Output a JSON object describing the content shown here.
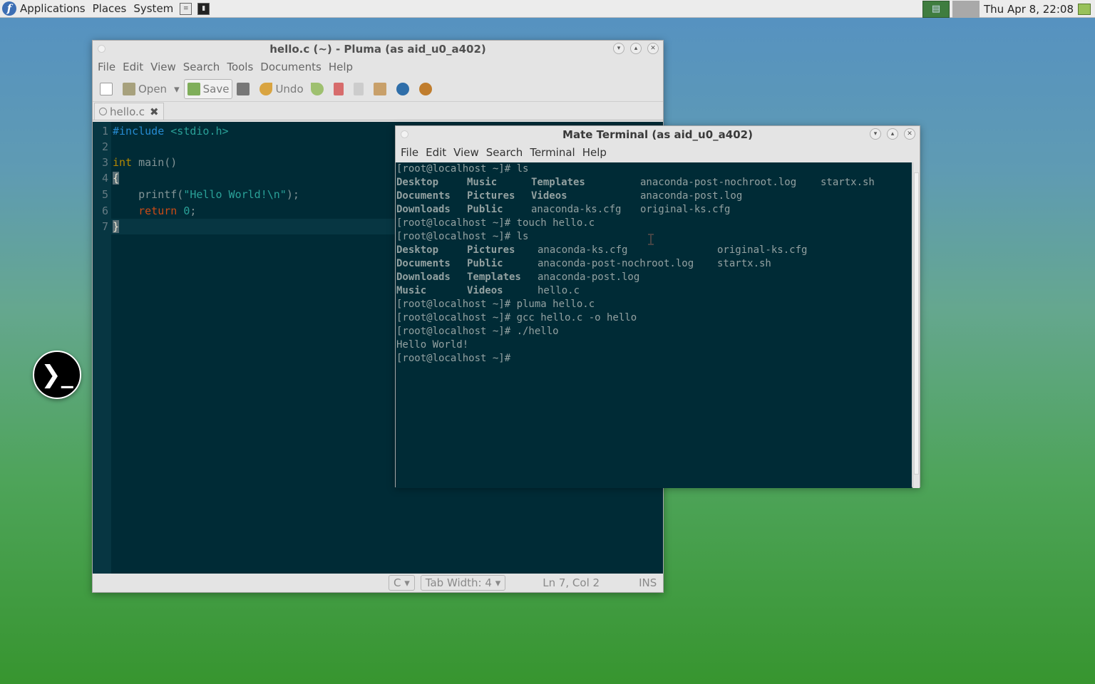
{
  "top_panel": {
    "menus": [
      "Applications",
      "Places",
      "System"
    ],
    "clock": "Thu Apr  8, 22:08"
  },
  "pluma": {
    "title": "hello.c (~) - Pluma (as aid_u0_a402)",
    "menu": [
      "File",
      "Edit",
      "View",
      "Search",
      "Tools",
      "Documents",
      "Help"
    ],
    "toolbar": {
      "open": "Open",
      "save": "Save",
      "undo": "Undo"
    },
    "tab": "hello.c",
    "line_numbers": [
      "1",
      "2",
      "3",
      "4",
      "5",
      "6",
      "7"
    ],
    "status": {
      "language": "C",
      "tab_width": "Tab Width:  4",
      "position": "Ln 7, Col 2",
      "mode": "INS"
    }
  },
  "terminal": {
    "title": "Mate Terminal (as aid_u0_a402)",
    "menu": [
      "File",
      "Edit",
      "View",
      "Search",
      "Terminal",
      "Help"
    ],
    "lines": [
      "[root@localhost ~]# ls",
      "[root@localhost ~]# touch hello.c",
      "[root@localhost ~]# ls",
      "[root@localhost ~]# pluma hello.c",
      "[root@localhost ~]# gcc hello.c -o hello",
      "[root@localhost ~]# ./hello",
      "Hello World!",
      "[root@localhost ~]#"
    ],
    "ls1": [
      [
        "Desktop",
        "Music",
        "Templates",
        "anaconda-post-nochroot.log",
        "startx.sh"
      ],
      [
        "Documents",
        "Pictures",
        "Videos",
        "anaconda-post.log"
      ],
      [
        "Downloads",
        "Public",
        "anaconda-ks.cfg",
        "original-ks.cfg"
      ]
    ],
    "ls2": [
      [
        "Desktop",
        "Pictures",
        "anaconda-ks.cfg",
        "original-ks.cfg"
      ],
      [
        "Documents",
        "Public",
        "anaconda-post-nochroot.log",
        "startx.sh"
      ],
      [
        "Downloads",
        "Templates",
        "anaconda-post.log"
      ],
      [
        "Music",
        "Videos",
        "hello.c"
      ]
    ]
  },
  "colors": {
    "terminal_bg": "#002b36",
    "editor_bg": "#002b36",
    "panel_bg": "#ececec"
  },
  "icons": [
    "fedora-logo-icon",
    "text-editor-launcher-icon",
    "terminal-launcher-icon",
    "terminal-fab-icon"
  ]
}
